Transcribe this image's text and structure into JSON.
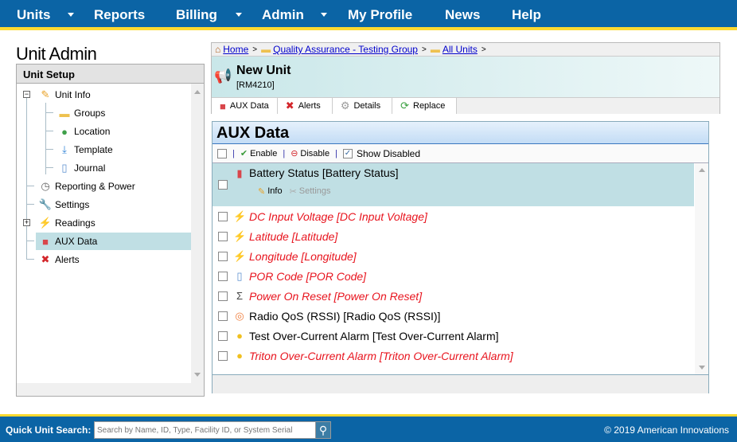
{
  "nav": {
    "items": [
      {
        "label": "Units",
        "dropdown": true
      },
      {
        "label": "Reports"
      },
      {
        "label": "Billing",
        "dropdown": true
      },
      {
        "label": "Admin",
        "dropdown": true
      },
      {
        "label": "My Profile"
      },
      {
        "label": "News"
      },
      {
        "label": "Help"
      }
    ]
  },
  "page_title": "Unit Admin",
  "sidebar": {
    "header": "Unit Setup",
    "items": [
      {
        "label": "Unit Info",
        "icon": "pencil-icon",
        "expanded": true
      },
      {
        "label": "Groups",
        "icon": "folder-icon"
      },
      {
        "label": "Location",
        "icon": "globe-icon"
      },
      {
        "label": "Template",
        "icon": "download-icon"
      },
      {
        "label": "Journal",
        "icon": "scroll-icon"
      },
      {
        "label": "Reporting & Power",
        "icon": "clock-icon"
      },
      {
        "label": "Settings",
        "icon": "wrench-icon"
      },
      {
        "label": "Readings",
        "icon": "lightning-icon",
        "expanded": false
      },
      {
        "label": "AUX Data",
        "icon": "cubes-icon",
        "selected": true
      },
      {
        "label": "Alerts",
        "icon": "error-icon"
      }
    ]
  },
  "breadcrumb": [
    "Home",
    "Quality Assurance - Testing Group",
    "All Units"
  ],
  "unit": {
    "name": "New Unit",
    "id": "[RM4210]"
  },
  "tabs": [
    {
      "label": "AUX Data",
      "icon": "cubes-icon"
    },
    {
      "label": "Alerts",
      "icon": "error-icon"
    },
    {
      "label": "Details",
      "icon": "gear-icon"
    },
    {
      "label": "Replace",
      "icon": "refresh-icon"
    }
  ],
  "aux": {
    "title": "AUX Data",
    "toolbar": {
      "enable": "Enable",
      "disable": "Disable",
      "show_disabled": "Show Disabled",
      "show_disabled_checked": true
    },
    "selected_actions": {
      "info": "Info",
      "settings": "Settings"
    },
    "items": [
      {
        "label": "Battery Status [Battery Status]",
        "icon": "battery-icon",
        "disabled": false,
        "selected": true
      },
      {
        "label": "DC Input Voltage [DC Input Voltage]",
        "icon": "lightning-icon",
        "disabled": true
      },
      {
        "label": "Latitude [Latitude]",
        "icon": "lightning-icon",
        "disabled": true
      },
      {
        "label": "Longitude [Longitude]",
        "icon": "lightning-icon",
        "disabled": true
      },
      {
        "label": "POR Code [POR Code]",
        "icon": "scroll-icon",
        "disabled": true
      },
      {
        "label": "Power On Reset [Power On Reset]",
        "icon": "sigma-icon",
        "disabled": true
      },
      {
        "label": "Radio QoS (RSSI) [Radio QoS (RSSI)]",
        "icon": "antenna-icon",
        "disabled": false
      },
      {
        "label": "Test Over-Current Alarm [Test Over-Current Alarm]",
        "icon": "lightbulb-icon",
        "disabled": false
      },
      {
        "label": "Triton Over-Current Alarm [Triton Over-Current Alarm]",
        "icon": "lightbulb-icon",
        "disabled": true
      }
    ]
  },
  "footer": {
    "search_label": "Quick Unit Search:",
    "search_placeholder": "Search by Name, ID, Type, Facility ID, or System Serial",
    "copyright": "© 2019 American Innovations"
  },
  "colors": {
    "nav": "#0b64a5",
    "accent": "#fcd930",
    "disabled_text": "#e8141e",
    "selected_row": "#c0dfe4"
  }
}
